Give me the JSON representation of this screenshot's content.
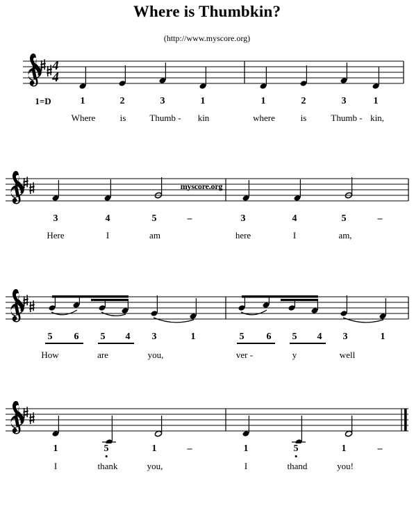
{
  "header": {
    "title": "Where is Thumbkin?",
    "subtitle": "(http://www.myscore.org)"
  },
  "watermark": {
    "text": "myscore.org"
  },
  "score": {
    "clef": "treble-clef",
    "key_signature": "2 sharps (D major)",
    "time_signature": "4/4",
    "key_label": "1=D",
    "systems": [
      {
        "id": "system-1",
        "numbers": [
          "1",
          "2",
          "3",
          "1",
          "1",
          "2",
          "3",
          "1"
        ],
        "lyrics": [
          "Where",
          "is",
          "Thumb -",
          "kin",
          "where",
          "is",
          "Thumb -",
          "kin,"
        ]
      },
      {
        "id": "system-2",
        "numbers": [
          "3",
          "4",
          "5",
          "–",
          "3",
          "4",
          "5",
          "–"
        ],
        "lyrics": [
          "Here",
          "I",
          "am",
          "",
          "here",
          "I",
          "am,",
          ""
        ]
      },
      {
        "id": "system-3",
        "numbers": [
          "5",
          "6",
          "5",
          "4",
          "3",
          "1",
          "5",
          "6",
          "5",
          "4",
          "3",
          "1"
        ],
        "lyrics": [
          "How",
          "",
          "are",
          "",
          "you,",
          "",
          "ver -",
          "",
          "y",
          "",
          "well",
          ""
        ]
      },
      {
        "id": "system-4",
        "numbers": [
          "1",
          "5",
          "1",
          "–",
          "1",
          "5",
          "1",
          "–"
        ],
        "lyrics": [
          "I",
          "thank",
          "you,",
          "",
          "I",
          "thand",
          "you!",
          ""
        ]
      }
    ]
  },
  "chart_data": {
    "type": "table",
    "title": "Where is Thumbkin? — numbered notation (jianpu) with staff",
    "key": "D major",
    "time": "4/4",
    "measures": [
      {
        "system": 1,
        "measure": 1,
        "notes": [
          {
            "degree": "1",
            "pitch": "D4",
            "duration": "quarter",
            "lyric": "Where"
          },
          {
            "degree": "2",
            "pitch": "E4",
            "duration": "quarter",
            "lyric": "is"
          },
          {
            "degree": "3",
            "pitch": "F#4",
            "duration": "quarter",
            "lyric": "Thumb -"
          },
          {
            "degree": "1",
            "pitch": "D4",
            "duration": "quarter",
            "lyric": "kin"
          }
        ]
      },
      {
        "system": 1,
        "measure": 2,
        "notes": [
          {
            "degree": "1",
            "pitch": "D4",
            "duration": "quarter",
            "lyric": "where"
          },
          {
            "degree": "2",
            "pitch": "E4",
            "duration": "quarter",
            "lyric": "is"
          },
          {
            "degree": "3",
            "pitch": "F#4",
            "duration": "quarter",
            "lyric": "Thumb -"
          },
          {
            "degree": "1",
            "pitch": "D4",
            "duration": "quarter",
            "lyric": "kin,"
          }
        ]
      },
      {
        "system": 2,
        "measure": 3,
        "notes": [
          {
            "degree": "3",
            "pitch": "F#4",
            "duration": "quarter",
            "lyric": "Here"
          },
          {
            "degree": "4",
            "pitch": "G4",
            "duration": "quarter",
            "lyric": "I"
          },
          {
            "degree": "5",
            "pitch": "A4",
            "duration": "half",
            "lyric": "am"
          }
        ]
      },
      {
        "system": 2,
        "measure": 4,
        "notes": [
          {
            "degree": "3",
            "pitch": "F#4",
            "duration": "quarter",
            "lyric": "here"
          },
          {
            "degree": "4",
            "pitch": "G4",
            "duration": "quarter",
            "lyric": "I"
          },
          {
            "degree": "5",
            "pitch": "A4",
            "duration": "half",
            "lyric": "am,"
          }
        ]
      },
      {
        "system": 3,
        "measure": 5,
        "notes": [
          {
            "degree": "5",
            "pitch": "A4",
            "duration": "eighth",
            "lyric": "How",
            "tie": true
          },
          {
            "degree": "6",
            "pitch": "B4",
            "duration": "eighth",
            "lyric": ""
          },
          {
            "degree": "5",
            "pitch": "A4",
            "duration": "eighth",
            "lyric": "are",
            "tie": true
          },
          {
            "degree": "4",
            "pitch": "G4",
            "duration": "eighth",
            "lyric": ""
          },
          {
            "degree": "3",
            "pitch": "F#4",
            "duration": "quarter",
            "lyric": "you,",
            "tie": true
          },
          {
            "degree": "1",
            "pitch": "D4",
            "duration": "quarter",
            "lyric": ""
          }
        ]
      },
      {
        "system": 3,
        "measure": 6,
        "notes": [
          {
            "degree": "5",
            "pitch": "A4",
            "duration": "eighth",
            "lyric": "ver -",
            "tie": true
          },
          {
            "degree": "6",
            "pitch": "B4",
            "duration": "eighth",
            "lyric": ""
          },
          {
            "degree": "5",
            "pitch": "A4",
            "duration": "eighth",
            "lyric": "y"
          },
          {
            "degree": "4",
            "pitch": "G4",
            "duration": "eighth",
            "lyric": ""
          },
          {
            "degree": "3",
            "pitch": "F#4",
            "duration": "quarter",
            "lyric": "well",
            "tie": true
          },
          {
            "degree": "1",
            "pitch": "D4",
            "duration": "quarter",
            "lyric": ""
          }
        ]
      },
      {
        "system": 4,
        "measure": 7,
        "notes": [
          {
            "degree": "1",
            "pitch": "D4",
            "duration": "quarter",
            "lyric": "I"
          },
          {
            "degree": "5",
            "pitch": "A3",
            "duration": "quarter",
            "lyric": "thank",
            "octave": "low"
          },
          {
            "degree": "1",
            "pitch": "D4",
            "duration": "half",
            "lyric": "you,"
          }
        ]
      },
      {
        "system": 4,
        "measure": 8,
        "notes": [
          {
            "degree": "1",
            "pitch": "D4",
            "duration": "quarter",
            "lyric": "I"
          },
          {
            "degree": "5",
            "pitch": "A3",
            "duration": "quarter",
            "lyric": "thand",
            "octave": "low"
          },
          {
            "degree": "1",
            "pitch": "D4",
            "duration": "half",
            "lyric": "you!"
          }
        ]
      }
    ]
  },
  "colors": {
    "ink": "#000000",
    "paper": "#ffffff"
  }
}
